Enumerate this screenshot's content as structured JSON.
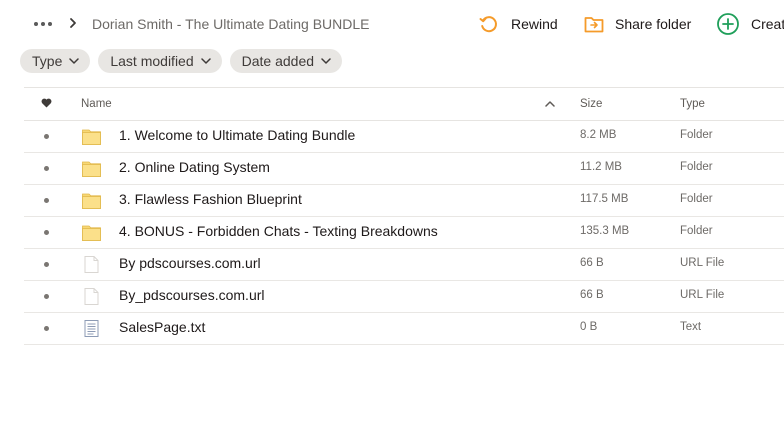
{
  "breadcrumb": {
    "title": "Dorian Smith - The Ultimate Dating BUNDLE"
  },
  "actions": {
    "rewind": "Rewind",
    "share_folder": "Share folder",
    "create": "Create"
  },
  "filters": [
    "Type",
    "Last modified",
    "Date added"
  ],
  "columns": {
    "name": "Name",
    "size": "Size",
    "type": "Type"
  },
  "colors": {
    "folder": "#f7d774",
    "accent_orange": "#f59b2a",
    "accent_green": "#1f9f5a",
    "chip_bg": "#e8e6e3"
  },
  "files": [
    {
      "icon": "folder-icon",
      "name": "1. Welcome to Ultimate Dating Bundle",
      "size": "8.2 MB",
      "type": "Folder"
    },
    {
      "icon": "folder-icon",
      "name": "2. Online Dating System",
      "size": "11.2 MB",
      "type": "Folder"
    },
    {
      "icon": "folder-icon",
      "name": "3. Flawless Fashion Blueprint",
      "size": "117.5 MB",
      "type": "Folder"
    },
    {
      "icon": "folder-icon",
      "name": "4. BONUS - Forbidden Chats - Texting Breakdowns",
      "size": "135.3 MB",
      "type": "Folder"
    },
    {
      "icon": "file-icon",
      "name": "By pdscourses.com.url",
      "size": "66 B",
      "type": "URL File"
    },
    {
      "icon": "file-icon",
      "name": "By_pdscourses.com.url",
      "size": "66 B",
      "type": "URL File"
    },
    {
      "icon": "text-file-icon",
      "name": "SalesPage.txt",
      "size": "0 B",
      "type": "Text"
    }
  ]
}
